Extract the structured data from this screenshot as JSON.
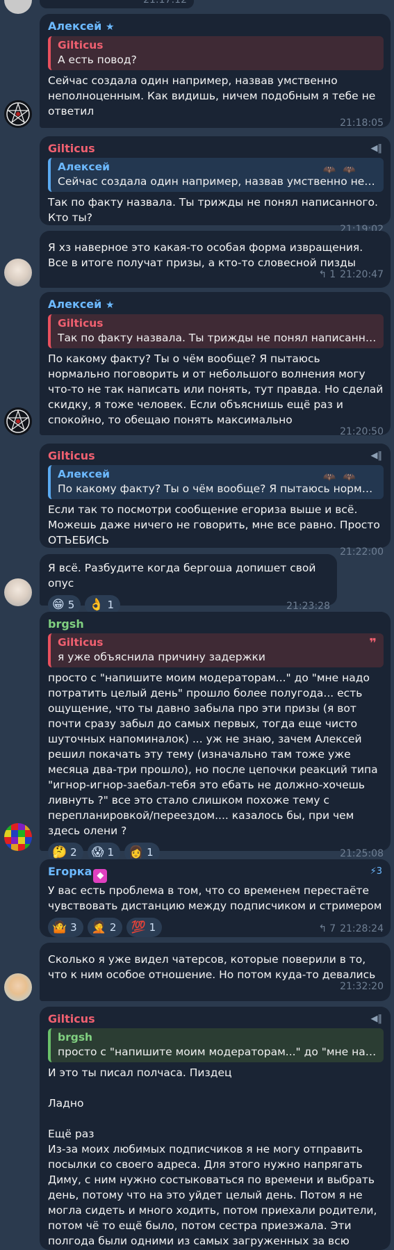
{
  "messages": [
    {
      "top_time": "21:17:12"
    },
    {
      "sender": "Алексей",
      "reply_name": "Gilticus",
      "reply_text": "А есть повод?",
      "text": "Сейчас создала один например, назвав умственно неполноценным. Как видишь, ничем подобным я тебе не ответил",
      "time": "21:18:05"
    },
    {
      "sender": "Gilticus",
      "reply_name": "Алексей",
      "reply_text": "Сейчас создала один например, назвав умственно непо...",
      "text": "Так по факту назвала. Ты трижды не понял написанного. Кто ты?",
      "time": "21:19:02"
    },
    {
      "text": "Я хз наверное это какая-то особая форма извращения. Все в итоге получат призы, а кто-то словесной пизды",
      "replies": "1",
      "time": "21:20:47"
    },
    {
      "sender": "Алексей",
      "reply_name": "Gilticus",
      "reply_text": "Так по факту назвала. Ты трижды не понял написанного....",
      "text": "По какому факту? Ты о чём вообще? Я пытаюсь нормально поговорить и от небольшого волнения могу что-то не так написать или понять, тут правда. Но сделай скидку, я тоже человек. Если объяснишь ещё раз и спокойно, то обещаю понять максимально",
      "time": "21:20:50"
    },
    {
      "sender": "Gilticus",
      "reply_name": "Алексей",
      "reply_text": "По какому факту? Ты о чём вообще? Я пытаюсь нормаль...",
      "text": "Если так то посмотри сообщение егориза выше и всё. Можешь даже ничего не говорить, мне все равно. Просто ОТЪЕБИСЬ",
      "time": "21:22:00"
    },
    {
      "text": "Я всё. Разбудите когда бергоша допишет свой опус",
      "reactions": [
        {
          "emoji": "😁",
          "count": "5"
        },
        {
          "emoji": "👌",
          "count": "1"
        }
      ],
      "time": "21:23:28"
    },
    {
      "sender": "brgsh",
      "reply_name": "Gilticus",
      "reply_text": "я уже объяснила причину задержки",
      "text": "просто с \"напишите моим модераторам...\" до \"мне надо потратить целый день\" прошло более полугода... есть ощущение, что ты давно забыла про эти призы (я вот почти сразу забыл до самых первых, тогда еще чисто шуточных напоминалок) ... уж не знаю, зачем Алексей решил покачать эту тему (изначально там тоже уже месяца два-три прошло), но после цепочки реакций типа \"игнор-игнор-заебал-тебя это ебать не должно-хочешь ливнуть ?\" все это стало слишком похоже тему с перепланировкой/переездом.... казалось бы, при чем здесь олени ?",
      "reactions": [
        {
          "emoji": "🤔",
          "count": "2"
        },
        {
          "emoji": "😱",
          "count": "1"
        },
        {
          "emoji": "👩",
          "count": "1"
        }
      ],
      "time": "21:25:08"
    },
    {
      "sender": "Егорка",
      "boost": "3",
      "text": "У вас есть проблема в том, что со временем перестаёте чувствовать дистанцию между подписчиком и стримером",
      "reactions": [
        {
          "emoji": "🤷",
          "count": "3"
        },
        {
          "emoji": "🤦",
          "count": "2"
        },
        {
          "emoji": "💯",
          "count": "1"
        }
      ],
      "replies": "7",
      "time": "21:28:24"
    },
    {
      "text": "Сколько я уже видел чатерсов, которые поверили в то, что к ним особое отношение. Но потом куда-то девались",
      "time": "21:32:20"
    },
    {
      "sender": "Gilticus",
      "reply_name": "brgsh",
      "reply_text": "просто с \"напишите моим модераторам...\" до \"мне надо ...",
      "text": "И это ты писал полчаса. Пиздец\n\nЛадно\n\nЕщё раз\nИз-за моих любимых подписчиков я не могу отправить посылки со своего адреса. Для этого нужно напрягать Диму, с ним нужно состыковаться по времени и выбрать день, потому что на это уйдет целый день. Потом я не могла сидеть и много ходить, потом приехали родители, потом чё то ещё было, потом сестра приезжала. Эти полгода были одними из самых загруженных за всю жизнь. Следующие"
    }
  ]
}
